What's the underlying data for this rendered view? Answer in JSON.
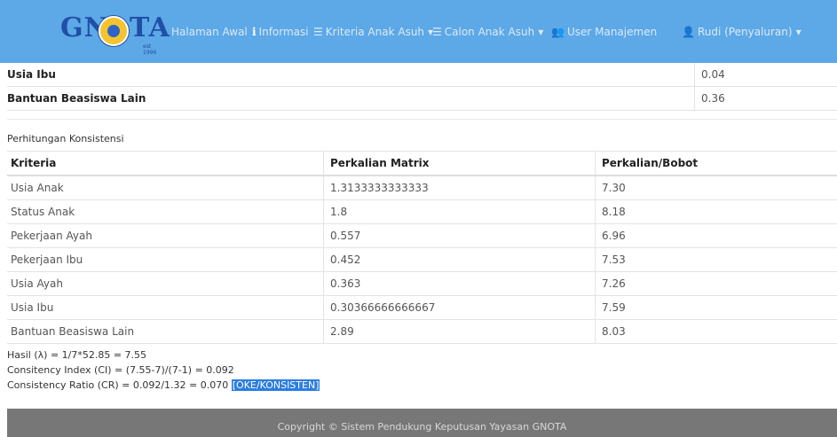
{
  "brand": {
    "left": "GN",
    "right": "TA",
    "est": "est 1996"
  },
  "nav": {
    "home": "Halaman Awal",
    "info": "Informasi",
    "criteria": "Kriteria Anak Asuh",
    "candidates": "Calon Anak Asuh",
    "users": "User Manajemen",
    "account": "Rudi (Penyaluran)"
  },
  "top_rows": [
    {
      "label": "Usia Ibu",
      "value": "0.04"
    },
    {
      "label": "Bantuan Beasiswa Lain",
      "value": "0.36"
    }
  ],
  "section_title": "Perhitungan Konsistensi",
  "consistency_table": {
    "headers": [
      "Kriteria",
      "Perkalian Matrix",
      "Perkalian/Bobot"
    ],
    "rows": [
      [
        "Usia Anak",
        "1.3133333333333",
        "7.30"
      ],
      [
        "Status Anak",
        "1.8",
        "8.18"
      ],
      [
        "Pekerjaan Ayah",
        "0.557",
        "6.96"
      ],
      [
        "Pekerjaan Ibu",
        "0.452",
        "7.53"
      ],
      [
        "Usia Ayah",
        "0.363",
        "7.26"
      ],
      [
        "Usia Ibu",
        "0.30366666666667",
        "7.59"
      ],
      [
        "Bantuan Beasiswa Lain",
        "2.89",
        "8.03"
      ]
    ]
  },
  "results": {
    "lambda": "Hasil (λ) = 1/7*52.85 = 7.55",
    "ci": "Consitency Index (CI) = (7.55-7)/(7-1) = 0.092",
    "cr": "Consistency Ratio (CR) = 0.092/1.32 = 0.070",
    "cr_status": "[OKE/KONSISTEN]"
  },
  "footer": "Copyright © Sistem Pendukung Keputusan Yayasan GNOTA",
  "colors": {
    "navbar": "#5da8e6",
    "highlight": "#2b7de0",
    "footer": "#777777"
  },
  "icons": {
    "info": "info-icon",
    "list": "list-icon",
    "users": "users-icon",
    "user": "user-icon"
  }
}
